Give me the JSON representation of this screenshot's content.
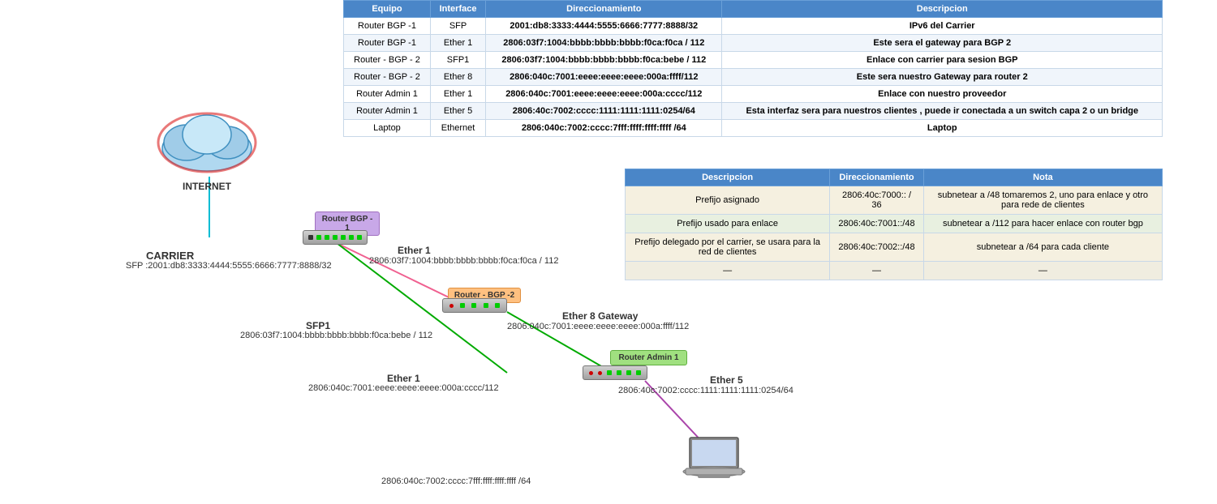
{
  "tables": {
    "main": {
      "headers": [
        "Equipo",
        "Interface",
        "Direccionamiento",
        "Descripcion"
      ],
      "rows": [
        {
          "equipo": "Router BGP -1",
          "interface": "SFP",
          "dir": "2001:db8:3333:4444:5555:6666:7777:8888/32",
          "desc": "IPv6 del Carrier"
        },
        {
          "equipo": "Router BGP -1",
          "interface": "Ether 1",
          "dir": "2806:03f7:1004:bbbb:bbbb:bbbb:f0ca:f0ca / 112",
          "desc": "Este sera el gateway para BGP 2"
        },
        {
          "equipo": "Router - BGP - 2",
          "interface": "SFP1",
          "dir": "2806:03f7:1004:bbbb:bbbb:bbbb:f0ca:bebe / 112",
          "desc": "Enlace con carrier para sesion BGP"
        },
        {
          "equipo": "Router - BGP - 2",
          "interface": "Ether 8",
          "dir": "2806:040c:7001:eeee:eeee:eeee:000a:ffff/112",
          "desc": "Este sera nuestro Gateway para router 2"
        },
        {
          "equipo": "Router Admin 1",
          "interface": "Ether 1",
          "dir": "2806:040c:7001:eeee:eeee:eeee:000a:cccc/112",
          "desc": "Enlace con nuestro proveedor"
        },
        {
          "equipo": "Router Admin 1",
          "interface": "Ether 5",
          "dir": "2806:40c:7002:cccc:1111:1111:1111:0254/64",
          "desc": "Esta interfaz sera para nuestros clientes , puede ir conectada a un switch capa 2 o un bridge"
        },
        {
          "equipo": "Laptop",
          "interface": "Ethernet",
          "dir": "2806:040c:7002:cccc:7fff:ffff:ffff:ffff /64",
          "desc": "Laptop"
        }
      ]
    },
    "second": {
      "headers": [
        "Descripcion",
        "Direccionamiento",
        "Nota"
      ],
      "rows": [
        {
          "desc": "Prefijo asignado",
          "dir": "2806:40c:7000:: / 36",
          "nota": "subnetear a /48  tomaremos 2, uno para enlace y otro para rede de clientes"
        },
        {
          "desc": "Prefijo usado para enlace",
          "dir": "2806:40c:7001::/48",
          "nota": "subnetear a /112 para hacer enlace con router bgp"
        },
        {
          "desc": "Prefijo delegado por el carrier, se usara para la red de clientes",
          "dir": "2806:40c:7002::/48",
          "nota": "subnetear a /64 para cada cliente"
        },
        {
          "desc": "—",
          "dir": "—",
          "nota": "—"
        }
      ]
    }
  },
  "diagram": {
    "internet_label": "INTERNET",
    "carrier_label": "CARRIER",
    "carrier_sfp": "SFP :2001:db8:3333:4444:5555:6666:7777:8888/32",
    "router_bgp1_label": "Router BGP -\n1",
    "router_bgp2_label": "Router - BGP -2",
    "router_admin1_label": "Router Admin 1",
    "laptop_label": "Laptop",
    "ether1_bgp1_label": "Ether 1",
    "ether1_bgp1_addr": "2806:03f7:1004:bbbb:bbbb:bbbb:f0ca:f0ca / 112",
    "sfp1_label": "SFP1",
    "sfp1_addr": "2806:03f7:1004:bbbb:bbbb:bbbb:f0ca:bebe / 112",
    "ether8_label": "Ether 8 Gateway",
    "ether8_addr": "2806:040c:7001:eeee:eeee:eeee:000a:ffff/112",
    "ether1_admin_label": "Ether 1",
    "ether1_admin_addr": "2806:040c:7001:eeee:eeee:eeee:000a:cccc/112",
    "ether5_label": "Ether 5",
    "ether5_addr": "2806:40c:7002:cccc:1111:1111:1111:0254/64",
    "laptop_addr": "2806:040c:7002:cccc:7fff:ffff:ffff:ffff /64"
  }
}
